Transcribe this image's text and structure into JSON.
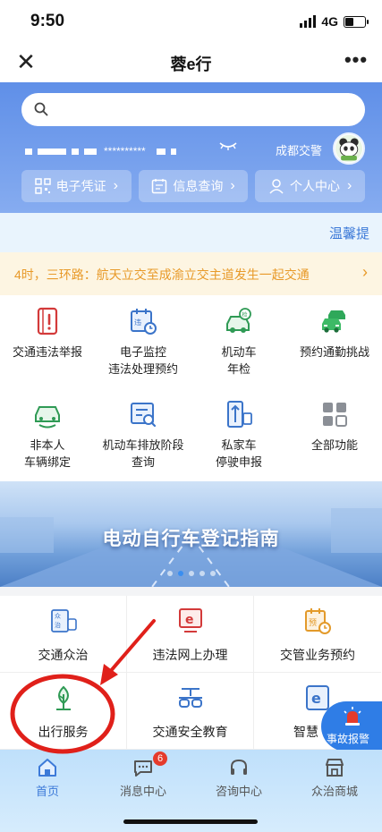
{
  "status_bar": {
    "time": "9:50",
    "network": "4G"
  },
  "title_bar": {
    "title": "蓉e行"
  },
  "header": {
    "masked_account": "**********",
    "org_name": "成都交警",
    "quick_actions": [
      {
        "label": "电子凭证",
        "icon": "qr-code-icon"
      },
      {
        "label": "信息查询",
        "icon": "calendar-search-icon"
      },
      {
        "label": "个人中心",
        "icon": "person-icon"
      }
    ]
  },
  "tips": {
    "label": "温馨提"
  },
  "notice": {
    "text": "4时，三环路：航天立交至成渝立交主道发生一起交通"
  },
  "functions": [
    {
      "label": "交通违法举报",
      "icon": "report-icon"
    },
    {
      "label": "电子监控\n违法处理预约",
      "icon": "violation-calendar-icon"
    },
    {
      "label": "机动车\n年检",
      "icon": "car-inspection-icon"
    },
    {
      "label": "预约通勤挑战",
      "icon": "cars-icon"
    },
    {
      "label": "非本人\n车辆绑定",
      "icon": "car-bind-icon"
    },
    {
      "label": "机动车排放阶段\n查询",
      "icon": "emission-query-icon"
    },
    {
      "label": "私家车\n停驶申报",
      "icon": "parking-declare-icon"
    },
    {
      "label": "全部功能",
      "icon": "grid-all-icon"
    }
  ],
  "banner": {
    "title": "电动自行车登记指南",
    "slide_count": 5,
    "active_slide": 2
  },
  "services": [
    {
      "label": "交通众治",
      "icon": "zhongzhi-icon"
    },
    {
      "label": "违法网上办理",
      "icon": "e-handle-icon"
    },
    {
      "label": "交管业务预约",
      "icon": "appointment-icon"
    },
    {
      "label": "出行服务",
      "icon": "tree-icon"
    },
    {
      "label": "交通安全教育",
      "icon": "glasses-icon"
    },
    {
      "label": "智慧",
      "icon": "e-smart-icon"
    }
  ],
  "accident": {
    "label": "事故报警"
  },
  "tabbar": [
    {
      "label": "首页",
      "icon": "home-icon",
      "active": true
    },
    {
      "label": "消息中心",
      "icon": "message-icon",
      "badge": "6"
    },
    {
      "label": "咨询中心",
      "icon": "headset-icon"
    },
    {
      "label": "众治商城",
      "icon": "shop-icon"
    }
  ],
  "colors": {
    "primary": "#3d7ad8",
    "header": "#6f9ceb",
    "notice": "#e89a2a",
    "highlight_circle": "#e0201a"
  }
}
